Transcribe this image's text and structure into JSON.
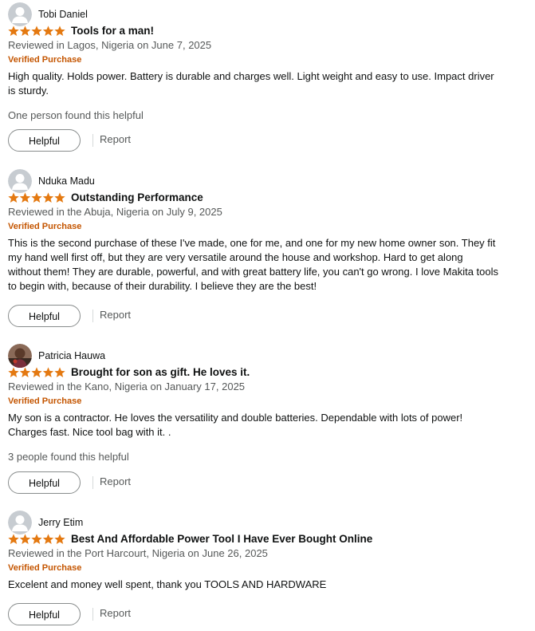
{
  "reviews": [
    {
      "reviewer": "Tobi Daniel",
      "avatar": "default-person-avatar",
      "rating": 5,
      "title": "Tools for a man!",
      "date": "Reviewed in Lagos, Nigeria on June 7, 2025",
      "verified": "Verified Purchase",
      "body": "High quality. Holds power. Battery is durable and charges well. Light weight and easy to use. Impact driver is sturdy.",
      "helpful_count": "One person found this helpful",
      "helpful_label": "Helpful",
      "report_label": "Report"
    },
    {
      "reviewer": "Nduka Madu",
      "avatar": "default-person-avatar",
      "rating": 5,
      "title": "Outstanding Performance",
      "date": "Reviewed in the Abuja, Nigeria on July 9, 2025",
      "verified": "Verified Purchase",
      "body": "This is the second purchase of these I've made, one for me, and one for my new home owner son. They fit my hand well first off, but they are very versatile around the house and workshop. Hard to get along without them! They are durable, powerful, and with great battery life, you can't go wrong. I love Makita tools to begin with, because of their durability. I believe they are the best!",
      "helpful_count": "",
      "helpful_label": "Helpful",
      "report_label": "Report"
    },
    {
      "reviewer": "Patricia Hauwa",
      "avatar": "profile-photo-avatar",
      "rating": 5,
      "title": "Brought for son as gift. He loves it.",
      "date": "Reviewed in the Kano, Nigeria on January 17, 2025",
      "verified": "Verified Purchase",
      "body": "My son is a contractor. He loves the versatility and double batteries. Dependable with lots of power! Charges fast. Nice tool bag with it. .",
      "helpful_count": "3 people found this helpful",
      "helpful_label": "Helpful",
      "report_label": "Report"
    },
    {
      "reviewer": "Jerry Etim",
      "avatar": "default-person-avatar",
      "rating": 5,
      "title": "Best And Affordable Power Tool I Have Ever Bought Online",
      "date": "Reviewed in the Port Harcourt, Nigeria on June 26, 2025",
      "verified": "Verified Purchase",
      "body": "Excelent and money well spent, thank you TOOLS AND HARDWARE",
      "helpful_count": "",
      "helpful_label": "Helpful",
      "report_label": "Report"
    }
  ],
  "colors": {
    "star": "#e47911",
    "verified": "#c45500",
    "muted_text": "#565959",
    "avatar_bg": "#c7ccd1",
    "avatar_fg": "#ffffff"
  }
}
